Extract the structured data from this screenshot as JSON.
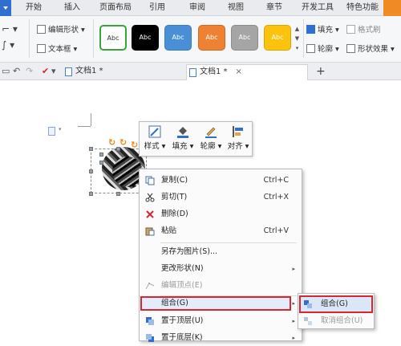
{
  "ribbon_tabs": [
    "开始",
    "插入",
    "页面布局",
    "引用",
    "审阅",
    "视图",
    "章节",
    "开发工具",
    "特色功能"
  ],
  "ribbon": {
    "edit_shape": "编辑形状",
    "text_box": "文本框",
    "style_label": "Abc",
    "fill": "填充",
    "format_painter": "格式刷",
    "outline": "轮廓",
    "shape_effects": "形状效果",
    "style_colors": [
      "#ffffff",
      "#000000",
      "#4a8fd6",
      "#ee8232",
      "#a5a5a5",
      "#fdc20d"
    ]
  },
  "doc_tabs": [
    {
      "label": "文档1 *"
    },
    {
      "label": "文档1 *"
    }
  ],
  "mini_toolbar": {
    "style": "样式",
    "fill": "填充",
    "outline": "轮廓",
    "align": "对齐"
  },
  "context_menu": {
    "copy": {
      "label": "复制(C)",
      "shortcut": "Ctrl+C"
    },
    "cut": {
      "label": "剪切(T)",
      "shortcut": "Ctrl+X"
    },
    "delete": {
      "label": "删除(D)"
    },
    "paste": {
      "label": "粘贴",
      "shortcut": "Ctrl+V"
    },
    "save_as_picture": {
      "label": "另存为图片(S)..."
    },
    "change_shape": {
      "label": "更改形状(N)"
    },
    "edit_points": {
      "label": "编辑顶点(E)"
    },
    "group": {
      "label": "组合(G)"
    },
    "bring_to_front": {
      "label": "置于顶层(U)"
    },
    "send_to_back": {
      "label": "置于底层(K)"
    }
  },
  "submenu": {
    "group": "组合(G)",
    "ungroup": "取消组合(U)"
  },
  "colors": {
    "highlight_red": "#d9252f",
    "accent_blue": "#2f6fd0",
    "rotate_orange": "#e88a1a"
  }
}
